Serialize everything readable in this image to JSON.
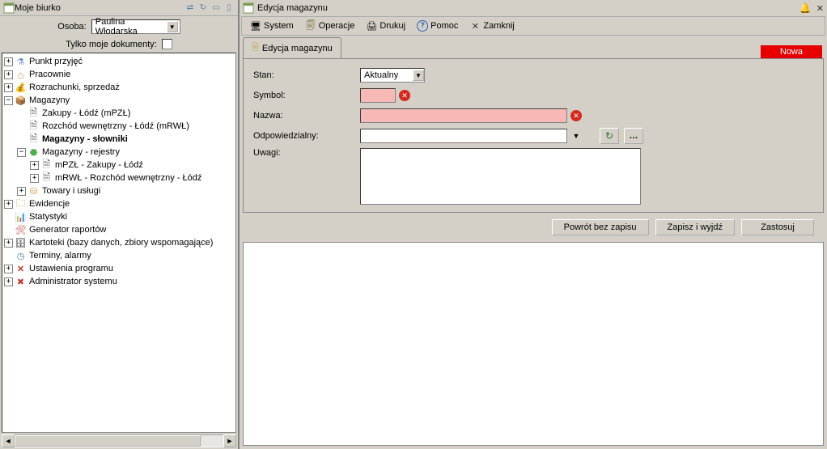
{
  "left": {
    "title": "Moje biurko",
    "osoba_label": "Osoba:",
    "osoba_value": "Paulina Włodarska",
    "mydocs_label": "Tylko moje dokumenty:"
  },
  "tree": {
    "n0": "Punkt przyjęć",
    "n1": "Pracownie",
    "n2": "Rozrachunki, sprzedaż",
    "n3": "Magazyny",
    "n3_0": "Zakupy - Łódź (mPZŁ)",
    "n3_1": "Rozchód wewnętrzny - Łódź (mRWŁ)",
    "n3_2": "Magazyny - słowniki",
    "n3_3": "Magazyny - rejestry",
    "n3_3_0": "mPZŁ - Zakupy - Łódź",
    "n3_3_1": "mRWŁ - Rozchód wewnętrzny - Łódź",
    "n3_4": "Towary i usługi",
    "n4": "Ewidencje",
    "n5": "Statystyki",
    "n6": "Generator raportów",
    "n7": "Kartoteki (bazy danych, zbiory wspomagające)",
    "n8": "Terminy, alarmy",
    "n9": "Ustawienia programu",
    "n10": "Administrator systemu"
  },
  "right": {
    "title": "Edycja magazynu",
    "menu": {
      "system": "System",
      "operacje": "Operacje",
      "drukuj": "Drukuj",
      "pomoc": "Pomoc",
      "zamknij": "Zamknij"
    },
    "tab": "Edycja magazynu",
    "badge": "Nowa",
    "form": {
      "stan_label": "Stan:",
      "stan_value": "Aktualny",
      "symbol_label": "Symbol:",
      "symbol_value": "",
      "nazwa_label": "Nazwa:",
      "nazwa_value": "",
      "odpowiedzialny_label": "Odpowiedzialny:",
      "odpowiedzialny_value": "",
      "uwagi_label": "Uwagi:",
      "uwagi_value": ""
    },
    "buttons": {
      "back": "Powrót bez zapisu",
      "save_exit": "Zapisz i wyjdź",
      "apply": "Zastosuj"
    }
  }
}
